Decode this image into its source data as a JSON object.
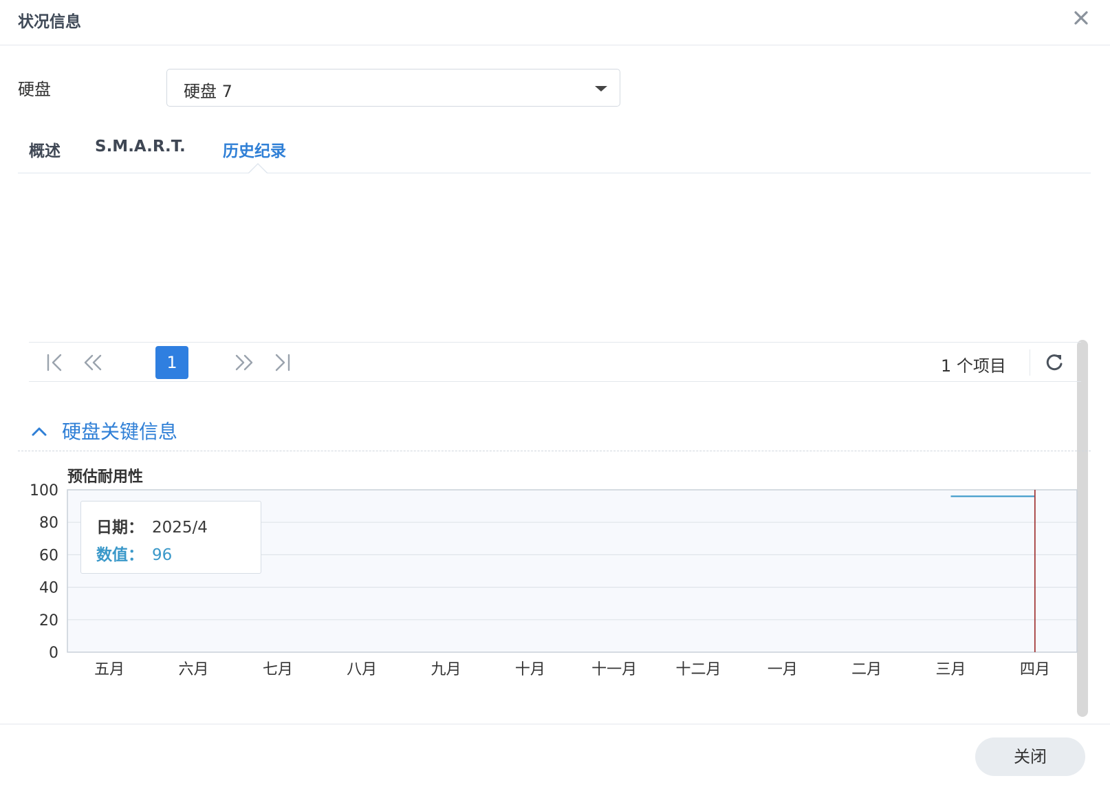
{
  "window": {
    "title": "状况信息"
  },
  "disk_field": {
    "label": "硬盘",
    "selected": "硬盘 7"
  },
  "tabs": [
    {
      "label": "概述",
      "active": false
    },
    {
      "label": "S.M.A.R.T.",
      "active": false
    },
    {
      "label": "历史纪录",
      "active": true
    }
  ],
  "pager": {
    "current_page": "1",
    "item_count": "1 个项目"
  },
  "section": {
    "title": "硬盘关键信息",
    "expanded": true
  },
  "tooltip": {
    "date_label": "日期：",
    "date_value": "2025/4",
    "value_label": "数值：",
    "value_value": "96"
  },
  "colors": {
    "accent": "#2f7fd6",
    "series": "#3a98c9",
    "cursor": "#a33a3a"
  },
  "footer": {
    "close_label": "关闭"
  },
  "chart_data": {
    "type": "line",
    "title": "预估耐用性",
    "categories": [
      "五月",
      "六月",
      "七月",
      "八月",
      "九月",
      "十月",
      "十一月",
      "十二月",
      "一月",
      "二月",
      "三月",
      "四月"
    ],
    "series": [
      {
        "values": [
          null,
          null,
          null,
          null,
          null,
          null,
          null,
          null,
          null,
          null,
          96,
          96
        ]
      }
    ],
    "yticks": [
      "0",
      "20",
      "40",
      "60",
      "80",
      "100"
    ],
    "ylim": [
      0,
      100
    ],
    "grid": true,
    "cursor_category": "四月"
  }
}
